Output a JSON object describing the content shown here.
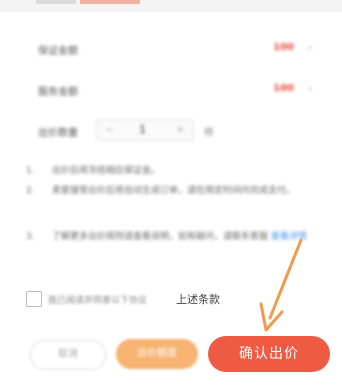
{
  "rows": [
    {
      "label": "保证金额",
      "value": "100"
    },
    {
      "label": "服务金额",
      "value": "100"
    }
  ],
  "stepper": {
    "label": "出价数量",
    "minus": "−",
    "qty": "1",
    "plus": "+",
    "unit": "件"
  },
  "notes": [
    {
      "num": "1.",
      "text": "出价后将冻结相应保证金。"
    },
    {
      "num": "2.",
      "text": "卖家接受出价后将自动生成订单，请在规定时间内完成支付。"
    },
    {
      "num": "3.",
      "text": "了解更多出价规则请查看说明，如有疑问，请联系客服",
      "link": "查看详情"
    }
  ],
  "agreement": {
    "prefix": "我已阅读并同意以下协议",
    "text": "上述条款"
  },
  "buttons": {
    "outline": "取消",
    "secondary": "出价额度",
    "confirm": "确认出价"
  },
  "colors": {
    "accent": "#ef5a43",
    "secondary": "#f7b372",
    "value_red": "#e8473a",
    "arrow": "#f29a4a"
  }
}
